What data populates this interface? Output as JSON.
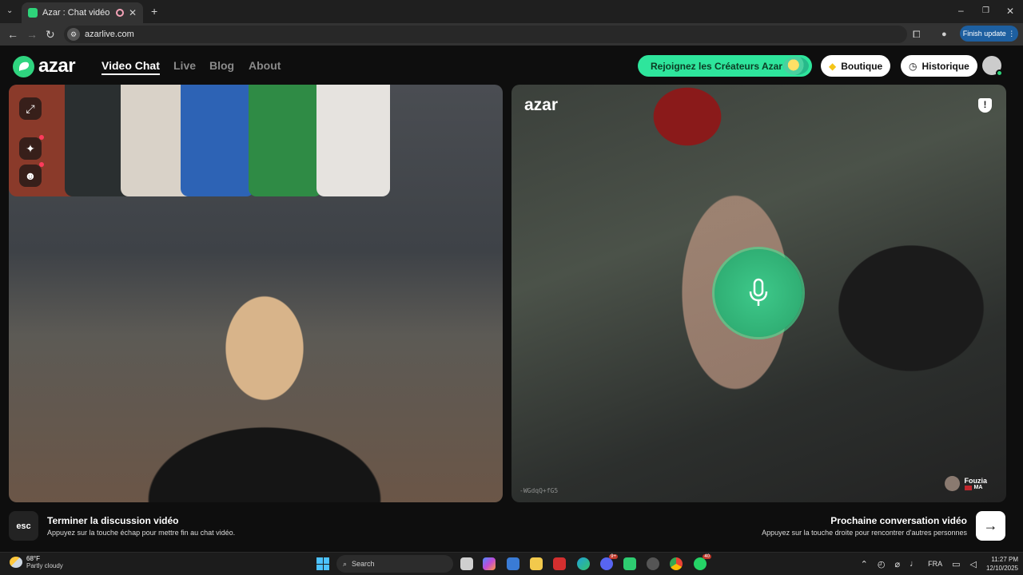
{
  "browser": {
    "tab_title": "Azar : Chat vidéo avec de n",
    "url": "azarlive.com",
    "finish_update": "Finish update"
  },
  "site": {
    "logo_text": "azar",
    "nav": [
      {
        "label": "Video Chat",
        "active": true
      },
      {
        "label": "Live",
        "active": false
      },
      {
        "label": "Blog",
        "active": false
      },
      {
        "label": "About",
        "active": false
      }
    ],
    "creators_button": "Rejoignez les Créateurs Azar",
    "boutique_button": "Boutique",
    "historique_button": "Historique",
    "brand_color": "#2fd47f"
  },
  "remote": {
    "logo_text": "azar",
    "watermark": "-WGdqQ+fG5",
    "peer_name": "Fouzia",
    "peer_country": "MA"
  },
  "actions": {
    "esc_key": "esc",
    "end_title": "Terminer la discussion vidéo",
    "end_subtitle": "Appuyez sur la touche échap pour mettre fin au chat vidéo.",
    "next_title": "Prochaine conversation vidéo",
    "next_subtitle": "Appuyez sur la touche droite pour rencontrer d'autres personnes"
  },
  "taskbar": {
    "temperature": "68°F",
    "weather": "Partly cloudy",
    "search_placeholder": "Search",
    "badge_discord": "9+",
    "badge_whatsapp": "40",
    "language": "FRA",
    "time": "11:27 PM",
    "date": "12/10/2025"
  }
}
